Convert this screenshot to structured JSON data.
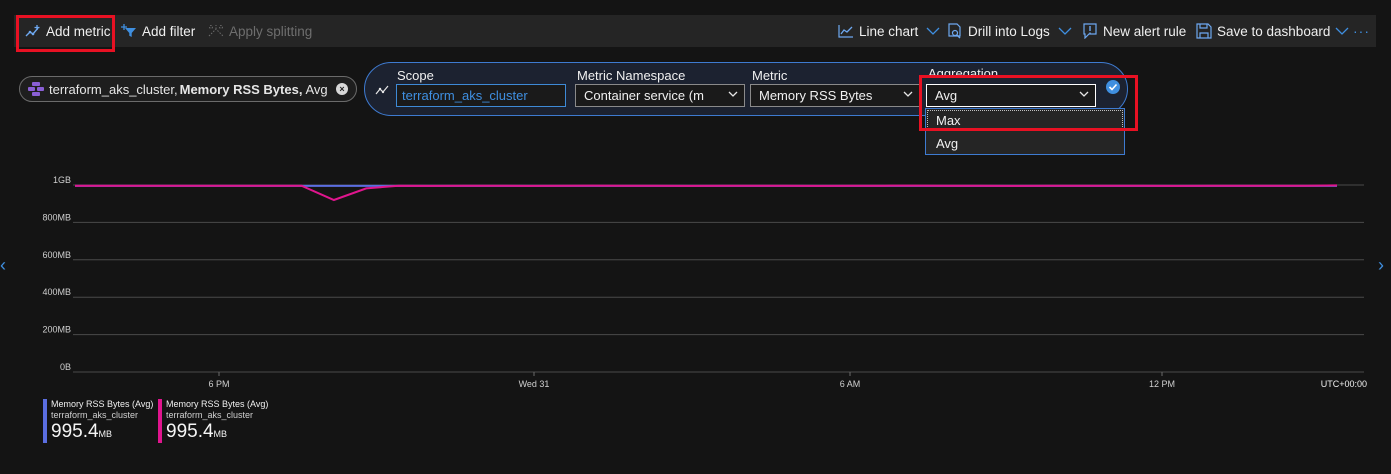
{
  "toolbar": {
    "add_metric": "Add metric",
    "add_filter": "Add filter",
    "apply_splitting": "Apply splitting",
    "line_chart": "Line chart",
    "drill_logs": "Drill into Logs",
    "new_alert": "New alert rule",
    "save_dashboard": "Save to dashboard",
    "more": "···"
  },
  "pill": {
    "resource": "terraform_aks_cluster,",
    "metric": "Memory RSS Bytes,",
    "aggregation": "Avg"
  },
  "editor": {
    "scope_label": "Scope",
    "scope_value": "terraform_aks_cluster",
    "namespace_label": "Metric Namespace",
    "namespace_value": "Container service (m",
    "metric_label": "Metric",
    "metric_value": "Memory RSS Bytes",
    "aggregation_label": "Aggregation",
    "aggregation_value": "Avg",
    "options": [
      "Max",
      "Avg"
    ]
  },
  "colors": {
    "accent": "#3f8fe0",
    "highlight": "#e81123",
    "series_avg": "#5b6ee1",
    "series_max": "#e0158e"
  },
  "chart_data": {
    "type": "line",
    "ylim": [
      0,
      1000
    ],
    "yticks": [
      "1GB",
      "800MB",
      "600MB",
      "400MB",
      "200MB",
      "0B"
    ],
    "xticks": [
      "6 PM",
      "Wed 31",
      "6 AM",
      "12 PM"
    ],
    "timezone": "UTC+00:00",
    "series": [
      {
        "name": "Memory RSS Bytes (Avg)",
        "resource": "terraform_aks_cluster",
        "summary": "995.4",
        "unit": "MB",
        "values": [
          995,
          995,
          995,
          995,
          995,
          995,
          995,
          995,
          995,
          995,
          995,
          995,
          995,
          995,
          995,
          995,
          995,
          995,
          995,
          995,
          995,
          995,
          995,
          995,
          995,
          995,
          995,
          995,
          995,
          995,
          995,
          995,
          995,
          995,
          995,
          995,
          995,
          995,
          995,
          995
        ]
      },
      {
        "name": "Memory RSS Bytes (Avg)",
        "resource": "terraform_aks_cluster",
        "summary": "995.4",
        "unit": "MB",
        "values": [
          996,
          996,
          996,
          996,
          996,
          996,
          996,
          996,
          920,
          982,
          996,
          995,
          996,
          996,
          995,
          996,
          997,
          996,
          996,
          995,
          996,
          996,
          996,
          995,
          996,
          996,
          997,
          996,
          996,
          995,
          996,
          996,
          996,
          996,
          995,
          996,
          996,
          996,
          996,
          998
        ]
      }
    ]
  }
}
